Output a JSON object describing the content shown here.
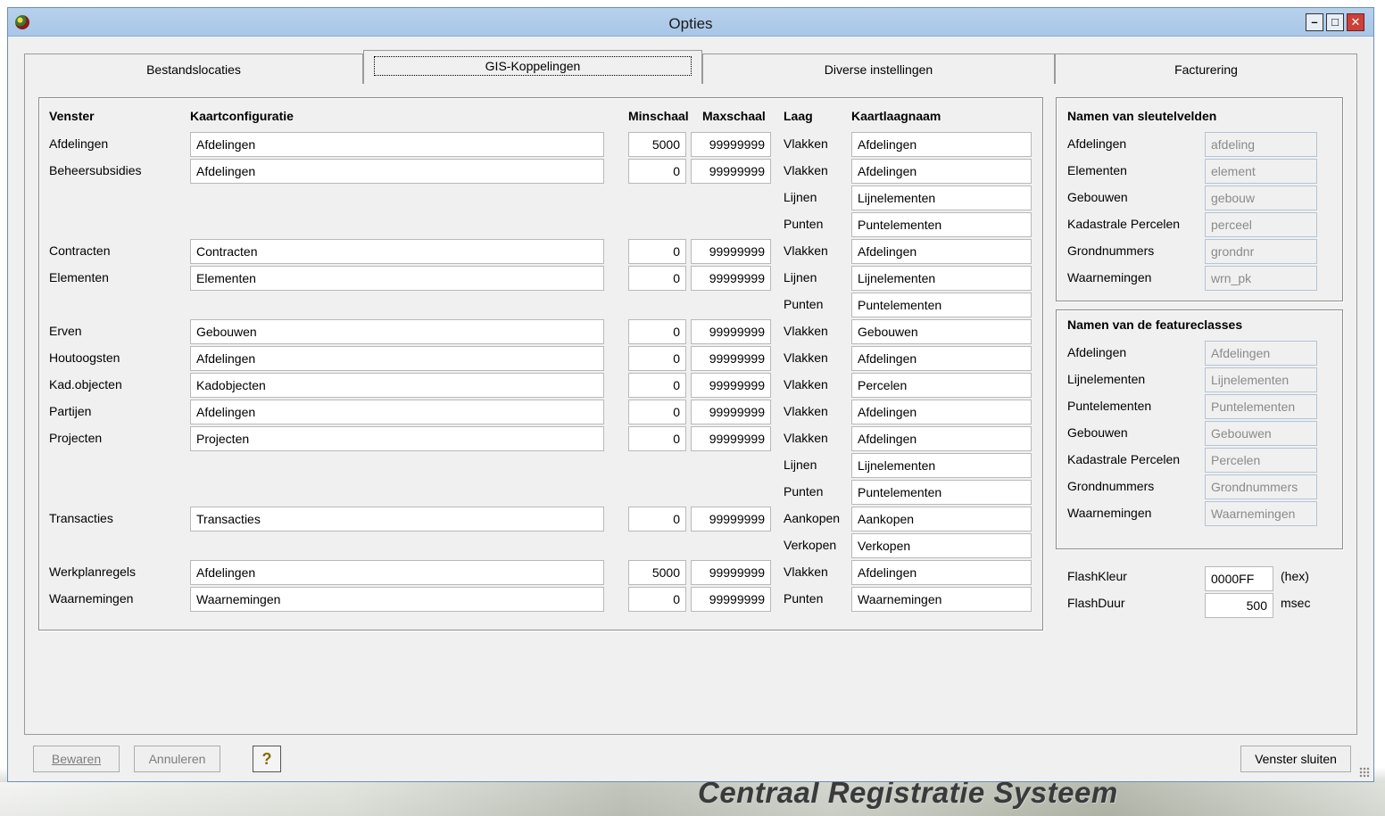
{
  "window": {
    "title": "Opties"
  },
  "tabs": [
    "Bestandslocaties",
    "GIS-Koppelingen",
    "Diverse instellingen",
    "Facturering"
  ],
  "gis": {
    "headers": {
      "venster": "Venster",
      "kaartconfiguratie": "Kaartconfiguratie",
      "minschaal": "Minschaal",
      "maxschaal": "Maxschaal",
      "laag": "Laag",
      "kaartlaagnaam": "Kaartlaagnaam"
    },
    "rows": [
      {
        "venster": "Afdelingen",
        "config": "Afdelingen",
        "min": "5000",
        "max": "99999999",
        "laag": "Vlakken",
        "kaartlaag": "Afdelingen"
      },
      {
        "venster": "Beheersubsidies",
        "config": "Afdelingen",
        "min": "0",
        "max": "99999999",
        "laag": "Vlakken",
        "kaartlaag": "Afdelingen"
      },
      {
        "venster": "",
        "config": "",
        "min": "",
        "max": "",
        "laag": "Lijnen",
        "kaartlaag": "Lijnelementen"
      },
      {
        "venster": "",
        "config": "",
        "min": "",
        "max": "",
        "laag": "Punten",
        "kaartlaag": "Puntelementen"
      },
      {
        "venster": "Contracten",
        "config": "Contracten",
        "min": "0",
        "max": "99999999",
        "laag": "Vlakken",
        "kaartlaag": "Afdelingen"
      },
      {
        "venster": "Elementen",
        "config": "Elementen",
        "min": "0",
        "max": "99999999",
        "laag": "Lijnen",
        "kaartlaag": "Lijnelementen"
      },
      {
        "venster": "",
        "config": "",
        "min": "",
        "max": "",
        "laag": "Punten",
        "kaartlaag": "Puntelementen"
      },
      {
        "venster": "Erven",
        "config": "Gebouwen",
        "min": "0",
        "max": "99999999",
        "laag": "Vlakken",
        "kaartlaag": "Gebouwen"
      },
      {
        "venster": "Houtoogsten",
        "config": "Afdelingen",
        "min": "0",
        "max": "99999999",
        "laag": "Vlakken",
        "kaartlaag": "Afdelingen"
      },
      {
        "venster": "Kad.objecten",
        "config": "Kadobjecten",
        "min": "0",
        "max": "99999999",
        "laag": "Vlakken",
        "kaartlaag": "Percelen"
      },
      {
        "venster": "Partijen",
        "config": "Afdelingen",
        "min": "0",
        "max": "99999999",
        "laag": "Vlakken",
        "kaartlaag": "Afdelingen"
      },
      {
        "venster": "Projecten",
        "config": "Projecten",
        "min": "0",
        "max": "99999999",
        "laag": "Vlakken",
        "kaartlaag": "Afdelingen"
      },
      {
        "venster": "",
        "config": "",
        "min": "",
        "max": "",
        "laag": "Lijnen",
        "kaartlaag": "Lijnelementen"
      },
      {
        "venster": "",
        "config": "",
        "min": "",
        "max": "",
        "laag": "Punten",
        "kaartlaag": "Puntelementen"
      },
      {
        "venster": "Transacties",
        "config": "Transacties",
        "min": "0",
        "max": "99999999",
        "laag": "Aankopen",
        "kaartlaag": "Aankopen"
      },
      {
        "venster": "",
        "config": "",
        "min": "",
        "max": "",
        "laag": "Verkopen",
        "kaartlaag": "Verkopen"
      },
      {
        "venster": "Werkplanregels",
        "config": "Afdelingen",
        "min": "5000",
        "max": "99999999",
        "laag": "Vlakken",
        "kaartlaag": "Afdelingen"
      },
      {
        "venster": "Waarnemingen",
        "config": "Waarnemingen",
        "min": "0",
        "max": "99999999",
        "laag": "Punten",
        "kaartlaag": "Waarnemingen"
      }
    ]
  },
  "keyfields": {
    "title": "Namen van sleutelvelden",
    "items": [
      {
        "label": "Afdelingen",
        "value": "afdeling"
      },
      {
        "label": "Elementen",
        "value": "element"
      },
      {
        "label": "Gebouwen",
        "value": "gebouw"
      },
      {
        "label": "Kadastrale Percelen",
        "value": "perceel"
      },
      {
        "label": "Grondnummers",
        "value": "grondnr"
      },
      {
        "label": "Waarnemingen",
        "value": "wrn_pk"
      }
    ]
  },
  "featureclasses": {
    "title": "Namen van de featureclasses",
    "items": [
      {
        "label": "Afdelingen",
        "value": "Afdelingen"
      },
      {
        "label": "Lijnelementen",
        "value": "Lijnelementen"
      },
      {
        "label": "Puntelementen",
        "value": "Puntelementen"
      },
      {
        "label": "Gebouwen",
        "value": "Gebouwen"
      },
      {
        "label": "Kadastrale Percelen",
        "value": "Percelen"
      },
      {
        "label": "Grondnummers",
        "value": "Grondnummers"
      },
      {
        "label": "Waarnemingen",
        "value": "Waarnemingen"
      }
    ]
  },
  "flash": {
    "kleur_label": "FlashKleur",
    "kleur_value": "0000FF",
    "kleur_unit": "(hex)",
    "duur_label": "FlashDuur",
    "duur_value": "500",
    "duur_unit": "msec"
  },
  "buttons": {
    "save": "Bewaren",
    "cancel": "Annuleren",
    "help": "?",
    "close": "Venster sluiten"
  },
  "brand": "Centraal Registratie Systeem"
}
